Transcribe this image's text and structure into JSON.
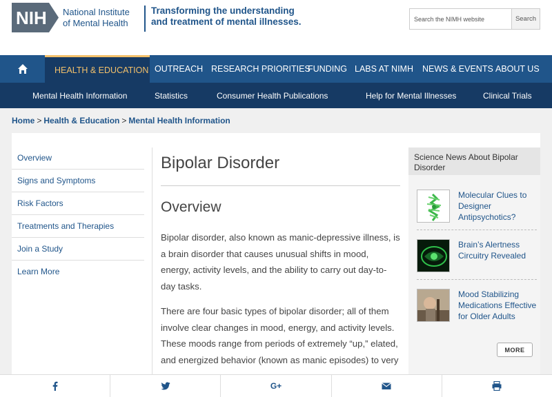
{
  "header": {
    "logo_text": "NIH",
    "institute_line1": "National Institute",
    "institute_line2": "of Mental Health",
    "tagline_line1": "Transforming the understanding",
    "tagline_line2": "and treatment of mental illnesses.",
    "search_placeholder": "Search the NIMH website",
    "search_button": "Search"
  },
  "main_nav": {
    "items": [
      {
        "label": "HEALTH & EDUCATION",
        "active": true
      },
      {
        "label": "OUTREACH"
      },
      {
        "label": "RESEARCH PRIORITIES"
      },
      {
        "label": "FUNDING"
      },
      {
        "label": "LABS AT NIMH"
      },
      {
        "label": "NEWS & EVENTS"
      },
      {
        "label": "ABOUT US"
      }
    ]
  },
  "sub_nav": {
    "items": [
      {
        "label": "Mental Health Information"
      },
      {
        "label": "Statistics"
      },
      {
        "label": "Consumer Health Publications"
      },
      {
        "label": "Help for Mental Illnesses"
      },
      {
        "label": "Clinical Trials"
      }
    ]
  },
  "breadcrumb": [
    "Home",
    "Health & Education",
    "Mental Health Information"
  ],
  "sidebar": {
    "items": [
      {
        "label": "Overview"
      },
      {
        "label": "Signs and Symptoms"
      },
      {
        "label": "Risk Factors"
      },
      {
        "label": "Treatments and Therapies"
      },
      {
        "label": "Join a Study"
      },
      {
        "label": "Learn More"
      }
    ]
  },
  "article": {
    "title": "Bipolar Disorder",
    "section_heading": "Overview",
    "paragraph1": "Bipolar disorder, also known as manic-depressive illness, is a brain disorder that causes unusual shifts in mood, energy, activity levels, and the ability to carry out day-to-day tasks.",
    "paragraph2": "There are four basic types of bipolar disorder; all of them involve clear changes in mood, energy, and activity levels. These moods range from periods of extremely “up,” elated, and energized behavior (known as manic episodes) to very"
  },
  "news": {
    "heading": "Science News About Bipolar Disorder",
    "items": [
      {
        "title": "Molecular Clues to Designer Antipsychotics?"
      },
      {
        "title": "Brain’s Alertness Circuitry Revealed"
      },
      {
        "title": "Mood Stabilizing Medications Effective for Older Adults"
      }
    ],
    "more_label": "MORE"
  },
  "share": {
    "icons": [
      "facebook-icon",
      "twitter-icon",
      "google-plus-icon",
      "email-icon",
      "print-icon"
    ],
    "google_plus_glyph": "G+"
  },
  "colors": {
    "brand_blue": "#20558a",
    "nav_dark": "#163a64",
    "active_gold": "#f3c06a"
  }
}
